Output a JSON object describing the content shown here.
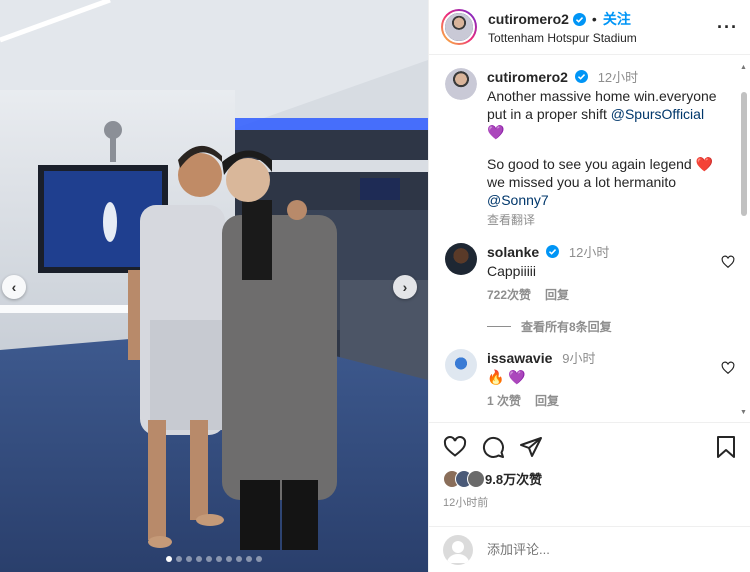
{
  "post": {
    "username": "cutiromero2",
    "separator": "•",
    "follow_label": "关注",
    "location": "Tottenham Hotspur Stadium",
    "more_label": "···"
  },
  "caption": {
    "username": "cutiromero2",
    "time": "12小时",
    "line1": "Another massive home win.everyone put in a proper shift ",
    "mention1": "@SpursOfficial",
    "line2": "So good to see you again legend ",
    "line3": "we missed you a lot hermanito",
    "mention2": "@Sonny7",
    "see_translation": "查看翻译"
  },
  "comments": [
    {
      "username": "solanke",
      "time": "12小时",
      "text": "Cappiiiii",
      "likes": "722次赞",
      "reply_label": "回复",
      "view_replies": "查看所有8条回复"
    },
    {
      "username": "issawavie",
      "time": "9小时",
      "text": "🔥 💜",
      "likes": "1 次赞",
      "reply_label": "回复"
    }
  ],
  "stats": {
    "likes": "9.8万次赞",
    "posted": "12小时前"
  },
  "comment_input": {
    "placeholder": "添加评论..."
  },
  "carousel": {
    "prev_icon": "chevron-left-icon",
    "next_icon": "chevron-right-icon",
    "dot_count": 10,
    "active_dot": 0
  },
  "colors": {
    "accent": "#0095f6",
    "verified": "#0095f6",
    "heart": "#ed4956",
    "muted": "#8e8e8e"
  }
}
